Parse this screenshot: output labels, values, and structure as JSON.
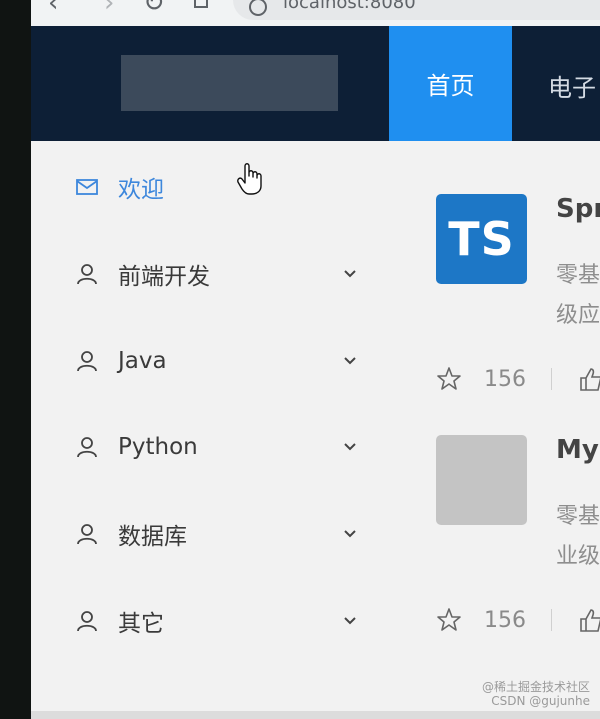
{
  "browser": {
    "url": "localhost:8080"
  },
  "header": {
    "nav": [
      {
        "label": "首页",
        "active": true
      },
      {
        "label": "电子"
      }
    ]
  },
  "sidebar": {
    "items": [
      {
        "label": "欢迎",
        "icon": "mail-icon",
        "active": true
      },
      {
        "label": "前端开发",
        "icon": "user-icon",
        "expandable": true
      },
      {
        "label": "Java",
        "icon": "user-icon",
        "expandable": true
      },
      {
        "label": "Python",
        "icon": "user-icon",
        "expandable": true
      },
      {
        "label": "数据库",
        "icon": "user-icon",
        "expandable": true
      },
      {
        "label": "其它",
        "icon": "user-icon",
        "expandable": true
      }
    ]
  },
  "articles": [
    {
      "thumb_text": "TS",
      "title": "Spr",
      "desc_lines": [
        "零基",
        "级应"
      ],
      "stars": "156"
    },
    {
      "thumb_text": "",
      "title": "Mys",
      "desc_lines": [
        "零基",
        "业级"
      ],
      "stars": "156"
    }
  ],
  "colors": {
    "header_bg": "#0d1f36",
    "active_tab": "#1f8ff0",
    "active_menu": "#3d87dc"
  },
  "watermark": [
    "@稀土掘金技术社区",
    "CSDN @gujunhe"
  ]
}
